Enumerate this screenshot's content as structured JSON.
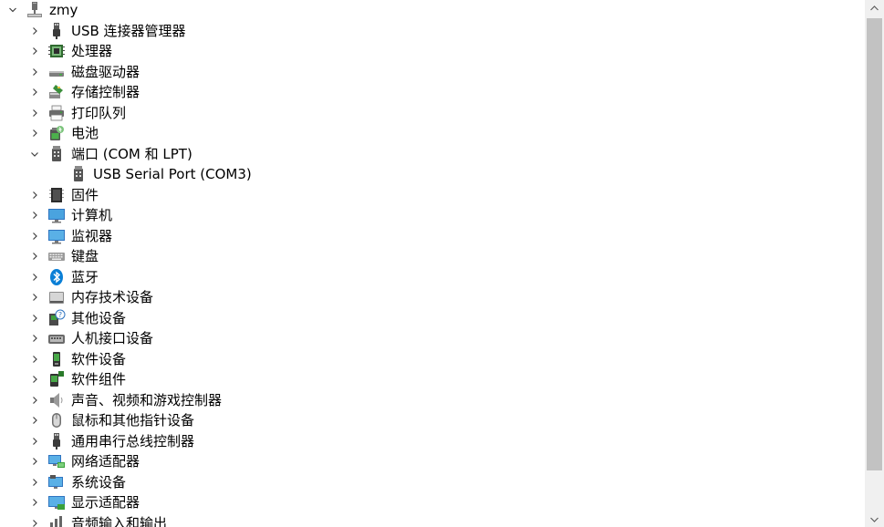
{
  "root": {
    "label": "zmy",
    "icon": "computer-icon",
    "expanded": true
  },
  "categories": [
    {
      "label": "USB 连接器管理器",
      "icon": "usb-connector-icon",
      "expanded": false
    },
    {
      "label": "处理器",
      "icon": "processor-icon",
      "expanded": false
    },
    {
      "label": "磁盘驱动器",
      "icon": "disk-drive-icon",
      "expanded": false
    },
    {
      "label": "存储控制器",
      "icon": "storage-controller-icon",
      "expanded": false
    },
    {
      "label": "打印队列",
      "icon": "printer-icon",
      "expanded": false
    },
    {
      "label": "电池",
      "icon": "battery-icon",
      "expanded": false
    },
    {
      "label": "端口 (COM 和 LPT)",
      "icon": "port-icon",
      "expanded": true,
      "children": [
        {
          "label": "USB Serial Port (COM3)",
          "icon": "serial-port-icon"
        }
      ]
    },
    {
      "label": "固件",
      "icon": "firmware-icon",
      "expanded": false
    },
    {
      "label": "计算机",
      "icon": "monitor-computer-icon",
      "expanded": false
    },
    {
      "label": "监视器",
      "icon": "monitor-icon",
      "expanded": false
    },
    {
      "label": "键盘",
      "icon": "keyboard-icon",
      "expanded": false
    },
    {
      "label": "蓝牙",
      "icon": "bluetooth-icon",
      "expanded": false
    },
    {
      "label": "内存技术设备",
      "icon": "memory-device-icon",
      "expanded": false
    },
    {
      "label": "其他设备",
      "icon": "unknown-device-icon",
      "expanded": false
    },
    {
      "label": "人机接口设备",
      "icon": "hid-icon",
      "expanded": false
    },
    {
      "label": "软件设备",
      "icon": "software-device-icon",
      "expanded": false
    },
    {
      "label": "软件组件",
      "icon": "software-component-icon",
      "expanded": false
    },
    {
      "label": "声音、视频和游戏控制器",
      "icon": "speaker-icon",
      "expanded": false
    },
    {
      "label": "鼠标和其他指针设备",
      "icon": "mouse-icon",
      "expanded": false
    },
    {
      "label": "通用串行总线控制器",
      "icon": "usb-controller-icon",
      "expanded": false
    },
    {
      "label": "网络适配器",
      "icon": "network-adapter-icon",
      "expanded": false
    },
    {
      "label": "系统设备",
      "icon": "system-device-icon",
      "expanded": false
    },
    {
      "label": "显示适配器",
      "icon": "display-adapter-icon",
      "expanded": false
    },
    {
      "label": "音频输入和输出",
      "icon": "audio-io-icon",
      "expanded": false
    }
  ],
  "colors": {
    "chevron": "#404040",
    "scroll_track": "#f0f0f0",
    "scroll_thumb": "#c2c2c2",
    "bluetooth": "#0a7fd6",
    "monitor_screen": "#4aa3df"
  }
}
